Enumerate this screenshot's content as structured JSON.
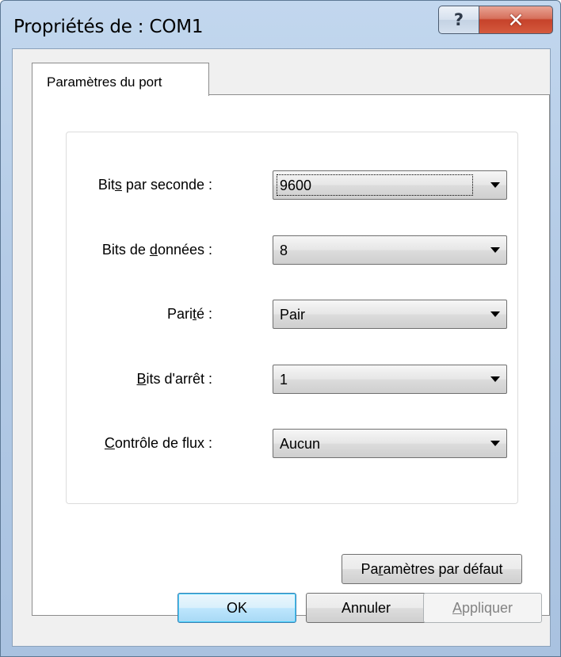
{
  "window": {
    "title": "Propriétés de : COM1",
    "help_icon": "?",
    "close_icon": "✕"
  },
  "tab": {
    "label": "Paramètres du port"
  },
  "fields": [
    {
      "label_pre": "Bit",
      "label_ul": "s",
      "label_post": " par seconde :",
      "value": "9600"
    },
    {
      "label_pre": "Bits de ",
      "label_ul": "d",
      "label_post": "onnées :",
      "value": "8"
    },
    {
      "label_pre": "Pari",
      "label_ul": "t",
      "label_post": "é :",
      "value": "Pair"
    },
    {
      "label_pre": "",
      "label_ul": "B",
      "label_post": "its d'arrêt :",
      "value": "1"
    },
    {
      "label_pre": "",
      "label_ul": "C",
      "label_post": "ontrôle de flux :",
      "value": "Aucun"
    }
  ],
  "buttons": {
    "defaults": {
      "pre": "Pa",
      "ul": "r",
      "post": "amètres par défaut"
    },
    "ok": "OK",
    "cancel": "Annuler",
    "apply": {
      "pre": "",
      "ul": "A",
      "post": "ppliquer"
    }
  }
}
